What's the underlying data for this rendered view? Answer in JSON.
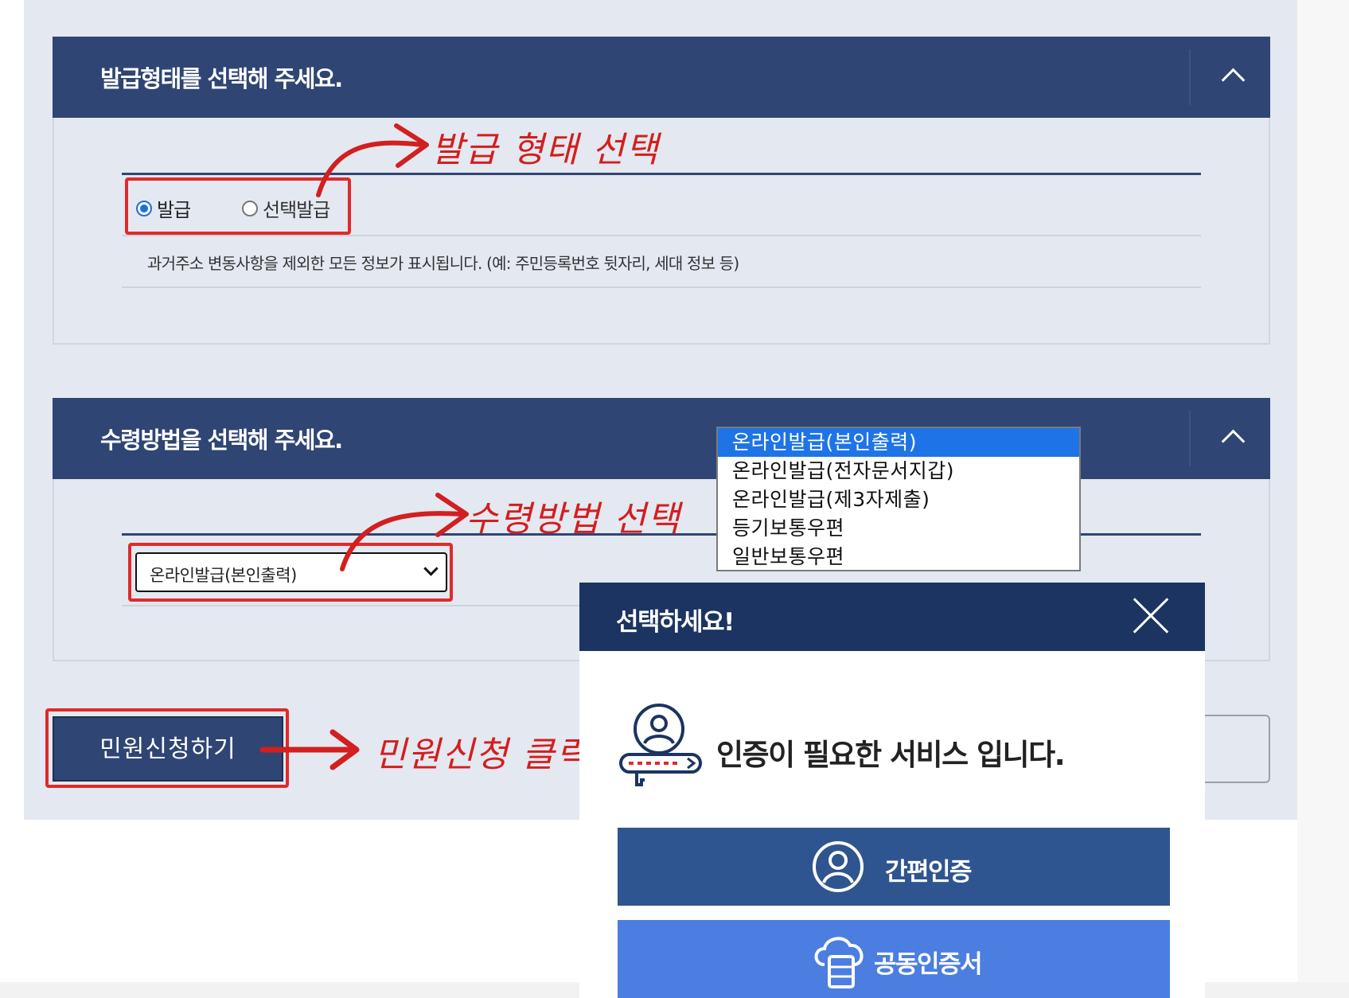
{
  "section1": {
    "title": "발급형태를 선택해 주세요.",
    "options": [
      {
        "label": "발급",
        "checked": true
      },
      {
        "label": "선택발급",
        "checked": false
      }
    ],
    "description": "과거주소 변동사항을 제외한 모든 정보가 표시됩니다. (예: 주민등록번호 뒷자리, 세대 정보 등)",
    "annotation": "발급 형태 선택"
  },
  "section2": {
    "title": "수령방법을 선택해 주세요.",
    "select_value": "온라인발급(본인출력)",
    "dropdown_options": [
      "온라인발급(본인출력)",
      "온라인발급(전자문서지갑)",
      "온라인발급(제3자제출)",
      "등기보통우편",
      "일반보통우편"
    ],
    "annotation": "수령방법 선택"
  },
  "apply": {
    "label": "민원신청하기",
    "annotation": "민원신청 클릭"
  },
  "modal": {
    "title": "선택하세요!",
    "message": "인증이 필요한 서비스 입니다.",
    "buttons": [
      {
        "label": "간편인증",
        "color": "#2e558f",
        "icon": "person-circle-icon"
      },
      {
        "label": "공동인증서",
        "color": "#4b7ee0",
        "icon": "cloud-certificate-icon"
      }
    ]
  },
  "colors": {
    "header": "#2f4574",
    "modal_header": "#1b3461",
    "annotation": "#d21f1f",
    "selected_option": "#1e74e6"
  }
}
